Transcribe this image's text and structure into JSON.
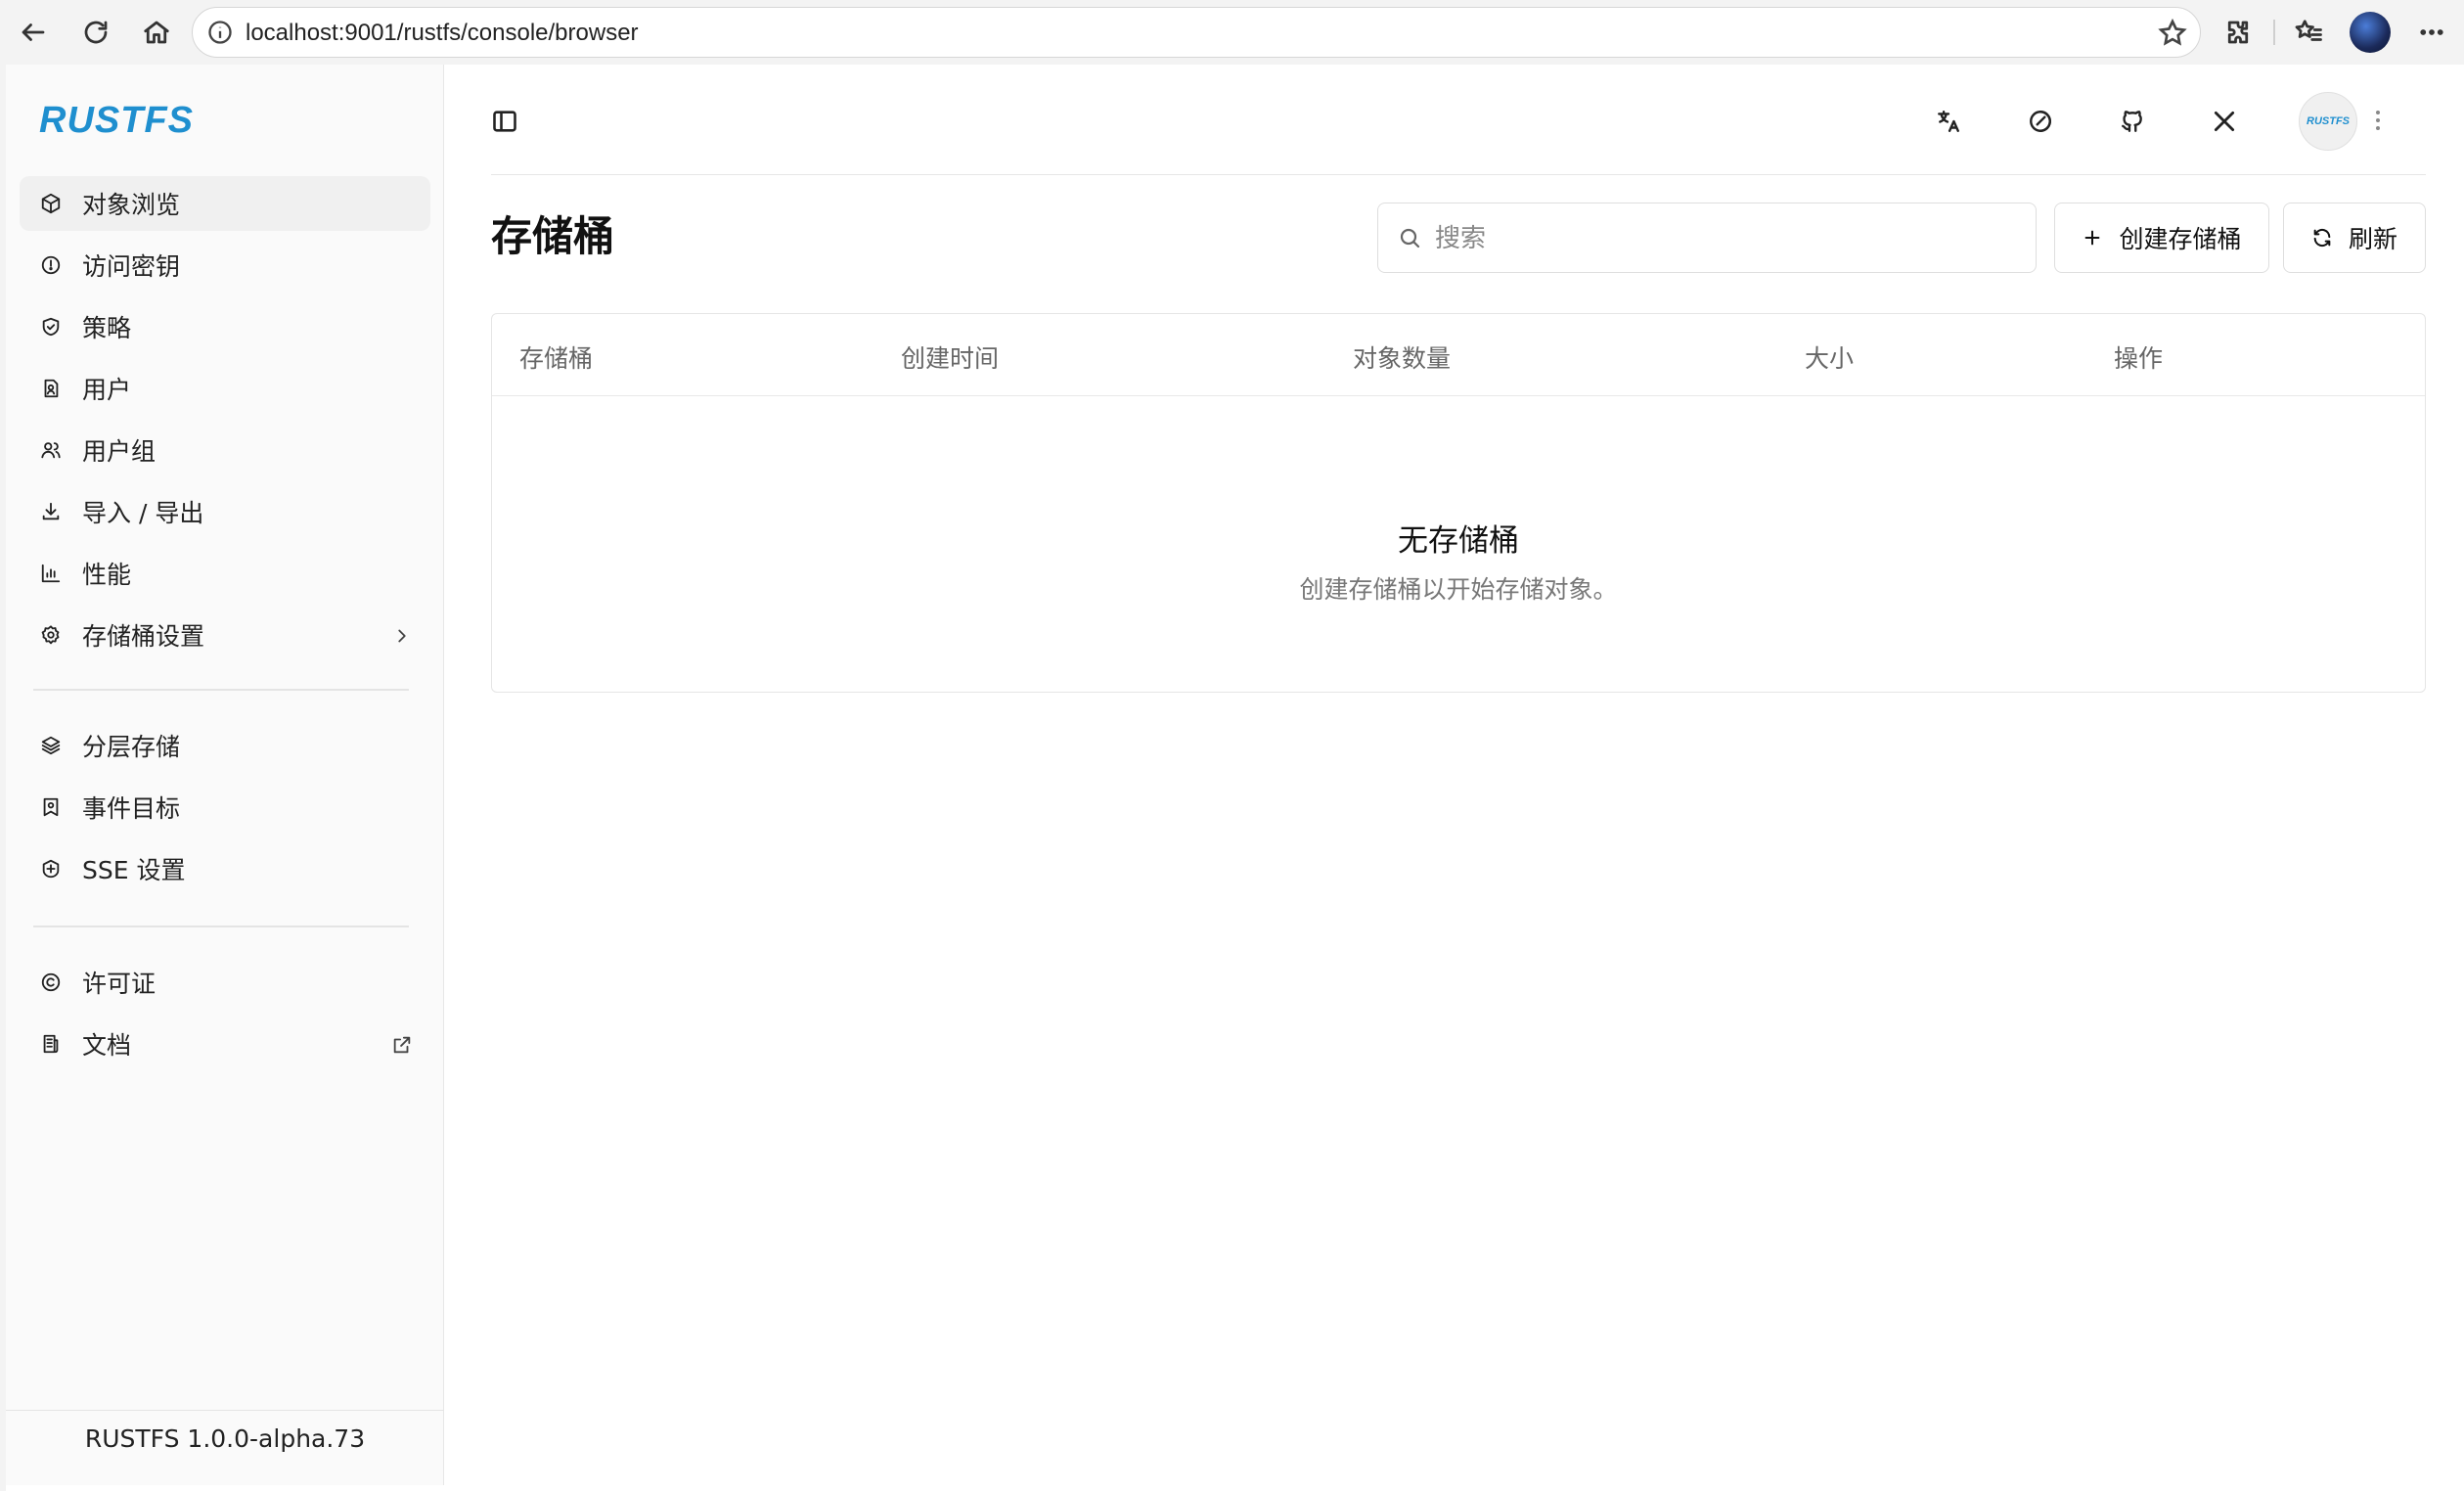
{
  "browser": {
    "url": "localhost:9001/rustfs/console/browser"
  },
  "brand": {
    "logo_text": "RUSTFS",
    "accent_color": "#1f8fcf"
  },
  "sidebar": {
    "primary_items": [
      {
        "label": "对象浏览",
        "icon": "cube-icon",
        "active": true
      },
      {
        "label": "访问密钥",
        "icon": "key-circle-icon"
      },
      {
        "label": "策略",
        "icon": "shield-check-icon"
      },
      {
        "label": "用户",
        "icon": "user-file-icon"
      },
      {
        "label": "用户组",
        "icon": "users-icon"
      },
      {
        "label": "导入 / 导出",
        "icon": "download-icon"
      },
      {
        "label": "性能",
        "icon": "bar-chart-icon"
      },
      {
        "label": "存储桶设置",
        "icon": "gear-icon",
        "has_submenu": true
      }
    ],
    "secondary_items": [
      {
        "label": "分层存储",
        "icon": "layers-icon"
      },
      {
        "label": "事件目标",
        "icon": "bookmark-icon"
      },
      {
        "label": "SSE 设置",
        "icon": "encryption-icon"
      }
    ],
    "tertiary_items": [
      {
        "label": "许可证",
        "icon": "copyright-icon"
      },
      {
        "label": "文档",
        "icon": "document-icon",
        "external": true
      }
    ],
    "version": "RUSTFS 1.0.0-alpha.73"
  },
  "header": {
    "icons": [
      "translate-icon",
      "theme-icon",
      "github-icon",
      "x-icon"
    ],
    "avatar_text": "RUSTFS"
  },
  "main": {
    "title": "存储桶",
    "search_placeholder": "搜索",
    "create_button": "创建存储桶",
    "refresh_button": "刷新",
    "table": {
      "columns": [
        "存储桶",
        "创建时间",
        "对象数量",
        "大小",
        "操作"
      ],
      "rows": [],
      "empty_title": "无存储桶",
      "empty_subtitle": "创建存储桶以开始存储对象。"
    }
  }
}
